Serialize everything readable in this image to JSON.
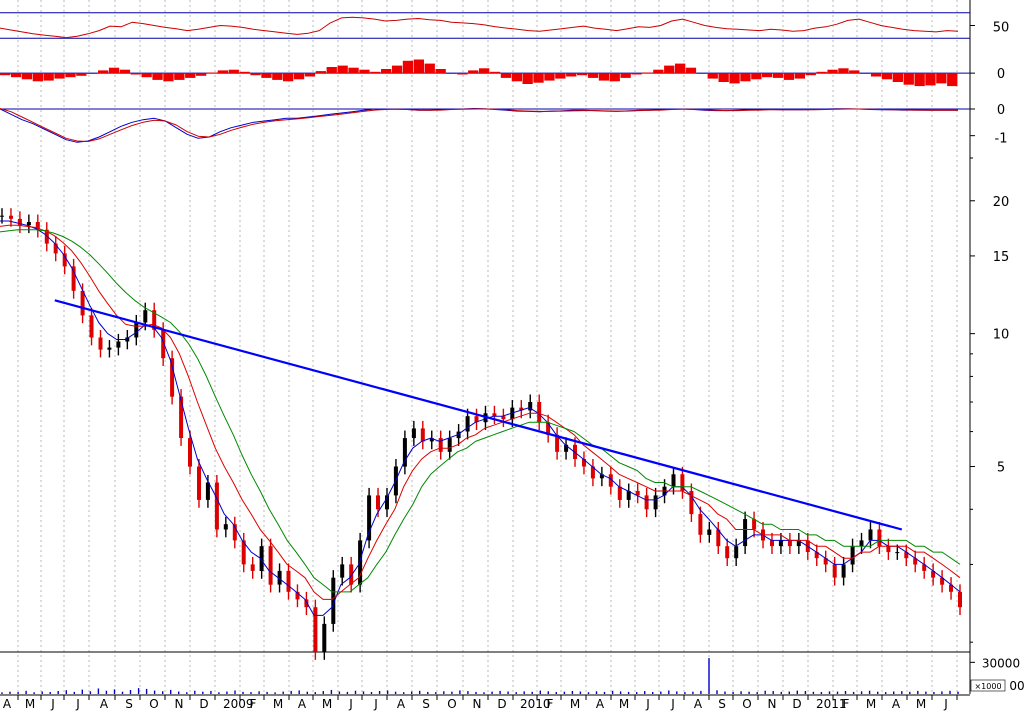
{
  "colors": {
    "background": "#ffffff",
    "grid": "#b8b8b8",
    "frame": "#000000",
    "rsi_line": "#cc0000",
    "rsi_band": "#0000aa",
    "hist_bar": "#ee0000",
    "hist_zero": "#0000aa",
    "macd_line": "#0000cc",
    "signal_line": "#cc0000",
    "candle_up": "#000000",
    "candle_down": "#dd0000",
    "ma_fast": "#0000cc",
    "ma_mid": "#dd0000",
    "ma_slow": "#008800",
    "trendline": "#0000ff",
    "volume": "#0000cc"
  },
  "chart_data": [
    {
      "panel": "rsi",
      "type": "line",
      "y_ticks": [
        "50"
      ],
      "levels": [
        70,
        30
      ],
      "range": [
        10,
        90
      ],
      "series": [
        {
          "values": [
            46,
            43,
            40,
            37,
            35,
            33,
            31,
            33,
            37,
            42,
            49,
            48,
            55,
            53,
            50,
            47,
            45,
            42,
            44,
            47,
            50,
            49,
            47,
            44,
            42,
            40,
            38,
            36,
            38,
            42,
            54,
            62,
            63,
            62,
            60,
            57,
            58,
            60,
            61,
            59,
            58,
            55,
            54,
            53,
            51,
            48,
            46,
            44,
            42,
            41,
            43,
            45,
            47,
            49,
            46,
            44,
            42,
            45,
            48,
            47,
            50,
            57,
            60,
            55,
            50,
            47,
            45,
            44,
            43,
            42,
            44,
            43,
            41,
            42,
            46,
            48,
            52,
            58,
            60,
            55,
            50,
            47,
            44,
            42,
            41,
            40,
            42,
            41
          ]
        }
      ]
    },
    {
      "panel": "histogram",
      "type": "bar",
      "y_ticks": [
        "0"
      ],
      "range": [
        -1.6,
        1.4
      ],
      "series": [
        {
          "values": [
            -0.15,
            -0.3,
            -0.45,
            -0.6,
            -0.55,
            -0.4,
            -0.3,
            -0.2,
            -0.05,
            0.2,
            0.4,
            0.25,
            -0.1,
            -0.3,
            -0.5,
            -0.6,
            -0.5,
            -0.35,
            -0.2,
            0.05,
            0.2,
            0.25,
            0.1,
            -0.15,
            -0.35,
            -0.5,
            -0.6,
            -0.45,
            -0.25,
            0.15,
            0.45,
            0.55,
            0.4,
            0.25,
            0.1,
            0.3,
            0.55,
            0.9,
            1.0,
            0.7,
            0.3,
            0.0,
            -0.1,
            0.2,
            0.35,
            0.1,
            -0.35,
            -0.6,
            -0.8,
            -0.7,
            -0.55,
            -0.4,
            -0.25,
            -0.15,
            -0.35,
            -0.55,
            -0.6,
            -0.35,
            -0.1,
            0.05,
            0.25,
            0.55,
            0.7,
            0.4,
            -0.05,
            -0.4,
            -0.65,
            -0.75,
            -0.6,
            -0.45,
            -0.3,
            -0.35,
            -0.5,
            -0.4,
            -0.15,
            0.1,
            0.25,
            0.35,
            0.2,
            -0.05,
            -0.25,
            -0.45,
            -0.65,
            -0.85,
            -0.95,
            -0.9,
            -0.75,
            -0.95
          ]
        }
      ]
    },
    {
      "panel": "macd",
      "type": "line",
      "y_ticks": [
        "0",
        "-1"
      ],
      "range": [
        -1.35,
        0.45
      ],
      "series": [
        {
          "values": [
            0.0,
            -0.2,
            -0.4,
            -0.55,
            -0.75,
            -0.95,
            -1.15,
            -1.25,
            -1.2,
            -1.05,
            -0.85,
            -0.65,
            -0.5,
            -0.4,
            -0.35,
            -0.45,
            -0.7,
            -0.95,
            -1.1,
            -1.05,
            -0.85,
            -0.7,
            -0.6,
            -0.5,
            -0.45,
            -0.4,
            -0.35,
            -0.35,
            -0.3,
            -0.25,
            -0.2,
            -0.15,
            -0.1,
            -0.05,
            0.0,
            0.0,
            0.0,
            -0.02,
            -0.05,
            -0.05,
            -0.03,
            0.0,
            0.0,
            0.02,
            0.01,
            -0.02,
            -0.05,
            -0.08,
            -0.09,
            -0.1,
            -0.08,
            -0.07,
            -0.05,
            -0.05,
            -0.06,
            -0.08,
            -0.09,
            -0.07,
            -0.05,
            -0.05,
            -0.03,
            0.0,
            0.0,
            -0.02,
            -0.05,
            -0.06,
            -0.06,
            -0.05,
            -0.03,
            -0.02,
            -0.02,
            -0.03,
            -0.03,
            -0.03,
            -0.02,
            0.0,
            0.01,
            0.01,
            0.0,
            -0.02,
            -0.03,
            -0.03,
            -0.04,
            -0.04,
            -0.05,
            -0.05,
            -0.05,
            -0.05
          ]
        },
        {
          "values": [
            0.02,
            -0.1,
            -0.3,
            -0.5,
            -0.7,
            -0.9,
            -1.1,
            -1.2,
            -1.22,
            -1.12,
            -0.95,
            -0.78,
            -0.62,
            -0.5,
            -0.42,
            -0.45,
            -0.6,
            -0.85,
            -1.02,
            -1.05,
            -0.95,
            -0.8,
            -0.68,
            -0.57,
            -0.5,
            -0.44,
            -0.4,
            -0.37,
            -0.33,
            -0.28,
            -0.24,
            -0.19,
            -0.14,
            -0.09,
            -0.04,
            -0.02,
            -0.01,
            -0.02,
            -0.04,
            -0.05,
            -0.04,
            -0.02,
            -0.01,
            0.0,
            0.0,
            -0.01,
            -0.03,
            -0.06,
            -0.08,
            -0.09,
            -0.09,
            -0.08,
            -0.07,
            -0.06,
            -0.06,
            -0.07,
            -0.08,
            -0.08,
            -0.06,
            -0.05,
            -0.04,
            -0.02,
            -0.01,
            -0.01,
            -0.03,
            -0.05,
            -0.06,
            -0.06,
            -0.05,
            -0.04,
            -0.03,
            -0.03,
            -0.03,
            -0.03,
            -0.03,
            -0.02,
            -0.01,
            0.0,
            0.0,
            -0.01,
            -0.02,
            -0.03,
            -0.03,
            -0.04,
            -0.04,
            -0.05,
            -0.05,
            -0.05
          ]
        }
      ]
    },
    {
      "panel": "price",
      "type": "line",
      "scale": "log",
      "y_ticks": [
        "20",
        "15",
        "10",
        "5"
      ],
      "ylim": [
        1.9,
        25
      ],
      "x": [
        "A",
        "M",
        "J",
        "J",
        "A",
        "S",
        "O",
        "N",
        "D",
        "2009",
        "F",
        "M",
        "A",
        "M",
        "J",
        "J",
        "A",
        "S",
        "O",
        "N",
        "D",
        "2010",
        "F",
        "M",
        "A",
        "M",
        "J",
        "J",
        "A",
        "S",
        "O",
        "N",
        "D",
        "2011",
        "F",
        "M",
        "A",
        "M",
        "J"
      ],
      "series": [
        {
          "values": [
            18.5,
            18.2,
            17.6,
            17.9,
            17.2,
            16.0,
            15.2,
            14.2,
            12.5,
            11.0,
            9.8,
            9.2,
            9.3,
            9.6,
            9.8,
            10.6,
            11.3,
            10.2,
            8.8,
            7.2,
            5.8,
            5.0,
            4.2,
            4.6,
            3.6,
            3.7,
            3.4,
            3.0,
            2.9,
            3.3,
            2.7,
            2.9,
            2.6,
            2.5,
            2.4,
            1.9,
            2.2,
            2.8,
            3.0,
            2.7,
            3.4,
            4.3,
            4.0,
            4.3,
            5.0,
            5.8,
            6.1,
            5.7,
            5.8,
            5.4,
            5.8,
            6.0,
            6.5,
            6.3,
            6.6,
            6.5,
            6.4,
            6.8,
            6.7,
            7.0,
            6.3,
            5.9,
            5.4,
            5.6,
            5.2,
            5.0,
            4.7,
            4.8,
            4.5,
            4.2,
            4.4,
            4.3,
            4.0,
            4.3,
            4.5,
            4.8,
            4.4,
            3.9,
            3.5,
            3.6,
            3.3,
            3.1,
            3.3,
            3.8,
            3.6,
            3.4,
            3.3,
            3.4,
            3.3,
            3.4,
            3.2,
            3.1,
            3.0,
            2.8,
            3.0,
            3.3,
            3.4,
            3.6,
            3.3,
            3.2,
            3.2,
            3.1,
            3.0,
            2.9,
            2.8,
            2.7,
            2.6,
            2.4
          ]
        },
        {
          "name": "",
          "values": [
            18.0,
            18.0,
            17.8,
            17.6,
            17.3,
            16.8,
            16.1,
            15.2,
            14.1,
            12.8,
            11.6,
            10.6,
            10.0,
            9.7,
            9.7,
            10.0,
            10.4,
            10.4,
            9.8,
            8.7,
            7.3,
            6.1,
            5.2,
            4.7,
            4.3,
            3.9,
            3.7,
            3.4,
            3.2,
            3.1,
            2.9,
            2.8,
            2.7,
            2.6,
            2.5,
            2.3,
            2.3,
            2.4,
            2.7,
            2.8,
            3.0,
            3.5,
            3.9,
            4.2,
            4.6,
            5.1,
            5.5,
            5.7,
            5.8,
            5.7,
            5.8,
            5.9,
            6.1,
            6.3,
            6.4,
            6.5,
            6.5,
            6.6,
            6.7,
            6.8,
            6.6,
            6.3,
            5.9,
            5.6,
            5.4,
            5.2,
            5.0,
            4.8,
            4.7,
            4.5,
            4.4,
            4.3,
            4.2,
            4.2,
            4.3,
            4.5,
            4.5,
            4.3,
            4.0,
            3.8,
            3.6,
            3.4,
            3.3,
            3.4,
            3.5,
            3.5,
            3.4,
            3.4,
            3.4,
            3.4,
            3.3,
            3.2,
            3.1,
            3.0,
            3.0,
            3.1,
            3.2,
            3.4,
            3.4,
            3.3,
            3.3,
            3.2,
            3.1,
            3.0,
            2.9,
            2.8,
            2.7,
            2.6
          ]
        },
        {
          "values": [
            17.5,
            17.6,
            17.6,
            17.5,
            17.4,
            17.1,
            16.7,
            16.1,
            15.4,
            14.5,
            13.5,
            12.5,
            11.7,
            11.0,
            10.5,
            10.4,
            10.4,
            10.5,
            10.3,
            9.8,
            9.0,
            8.0,
            7.0,
            6.2,
            5.5,
            5.0,
            4.6,
            4.2,
            3.9,
            3.6,
            3.4,
            3.2,
            3.0,
            2.9,
            2.8,
            2.6,
            2.5,
            2.5,
            2.6,
            2.7,
            2.8,
            3.1,
            3.4,
            3.7,
            4.0,
            4.5,
            4.9,
            5.2,
            5.4,
            5.5,
            5.5,
            5.6,
            5.8,
            5.9,
            6.1,
            6.2,
            6.3,
            6.4,
            6.5,
            6.6,
            6.6,
            6.5,
            6.3,
            6.1,
            5.9,
            5.6,
            5.4,
            5.2,
            5.0,
            4.8,
            4.7,
            4.6,
            4.5,
            4.4,
            4.4,
            4.4,
            4.4,
            4.3,
            4.2,
            4.1,
            3.9,
            3.8,
            3.6,
            3.6,
            3.6,
            3.5,
            3.5,
            3.5,
            3.4,
            3.4,
            3.4,
            3.3,
            3.3,
            3.2,
            3.1,
            3.1,
            3.2,
            3.2,
            3.3,
            3.3,
            3.3,
            3.3,
            3.2,
            3.2,
            3.1,
            3.0,
            2.9,
            2.8
          ]
        },
        {
          "values": [
            17.0,
            17.1,
            17.2,
            17.2,
            17.2,
            17.1,
            16.9,
            16.6,
            16.2,
            15.7,
            15.1,
            14.4,
            13.7,
            13.0,
            12.4,
            11.9,
            11.5,
            11.2,
            10.9,
            10.6,
            10.1,
            9.5,
            8.8,
            8.0,
            7.2,
            6.5,
            5.9,
            5.3,
            4.8,
            4.4,
            4.0,
            3.7,
            3.4,
            3.2,
            3.0,
            2.8,
            2.7,
            2.6,
            2.6,
            2.6,
            2.7,
            2.8,
            3.0,
            3.2,
            3.5,
            3.8,
            4.1,
            4.5,
            4.8,
            5.0,
            5.2,
            5.4,
            5.5,
            5.7,
            5.8,
            5.9,
            6.0,
            6.1,
            6.2,
            6.3,
            6.3,
            6.3,
            6.2,
            6.1,
            6.0,
            5.8,
            5.6,
            5.5,
            5.3,
            5.1,
            5.0,
            4.9,
            4.7,
            4.6,
            4.6,
            4.5,
            4.5,
            4.5,
            4.4,
            4.3,
            4.2,
            4.1,
            4.0,
            3.9,
            3.8,
            3.7,
            3.7,
            3.6,
            3.6,
            3.6,
            3.5,
            3.5,
            3.4,
            3.4,
            3.3,
            3.3,
            3.3,
            3.3,
            3.4,
            3.4,
            3.4,
            3.4,
            3.3,
            3.3,
            3.2,
            3.2,
            3.1,
            3.0
          ]
        }
      ],
      "trendline": {
        "start": [
          5.9,
          11.9
        ],
        "end": [
          100.5,
          3.6
        ]
      }
    },
    {
      "panel": "volume",
      "type": "bar",
      "y_ticks": [
        "30000",
        "×1000",
        "00"
      ],
      "range": [
        0,
        36000
      ],
      "series": [
        {
          "values": [
            1500,
            2200,
            1800,
            3000,
            1600,
            2400,
            1900,
            2800,
            3600,
            2000,
            4200,
            2600,
            5200,
            3100,
            4400,
            2200,
            3800,
            5600,
            4800,
            3200,
            2600,
            3900,
            2400,
            1700,
            3100,
            2200,
            2900,
            1600,
            2400,
            3300,
            2100,
            1800,
            2600,
            2000,
            1500,
            2300,
            2900,
            3400,
            2200,
            1800,
            2700,
            3900,
            2400,
            2000,
            3100,
            2500,
            1900,
            2800,
            3300,
            2200,
            1700,
            2400,
            3000,
            2000,
            1800,
            2600,
            2200,
            3400,
            2700,
            2000,
            1600,
            2300,
            2900,
            2400,
            1800,
            2500,
            2100,
            3200,
            2600,
            1900,
            2200,
            2800,
            2400,
            1700,
            2600,
            2000,
            3000,
            2500,
            2000,
            1800,
            2700,
            1900,
            2300,
            3300,
            2500,
            1800,
            2200,
            2900,
            34000,
            3500,
            2400,
            1900,
            2600,
            2200,
            1800,
            3100,
            2700,
            2000,
            2400,
            3200,
            2800,
            2100,
            1900,
            2500,
            2300,
            2800,
            2000,
            2600,
            3100,
            2200,
            1800,
            2400,
            2700,
            2100,
            2900,
            2300,
            1900,
            2500,
            3000,
            2200
          ]
        }
      ]
    }
  ]
}
